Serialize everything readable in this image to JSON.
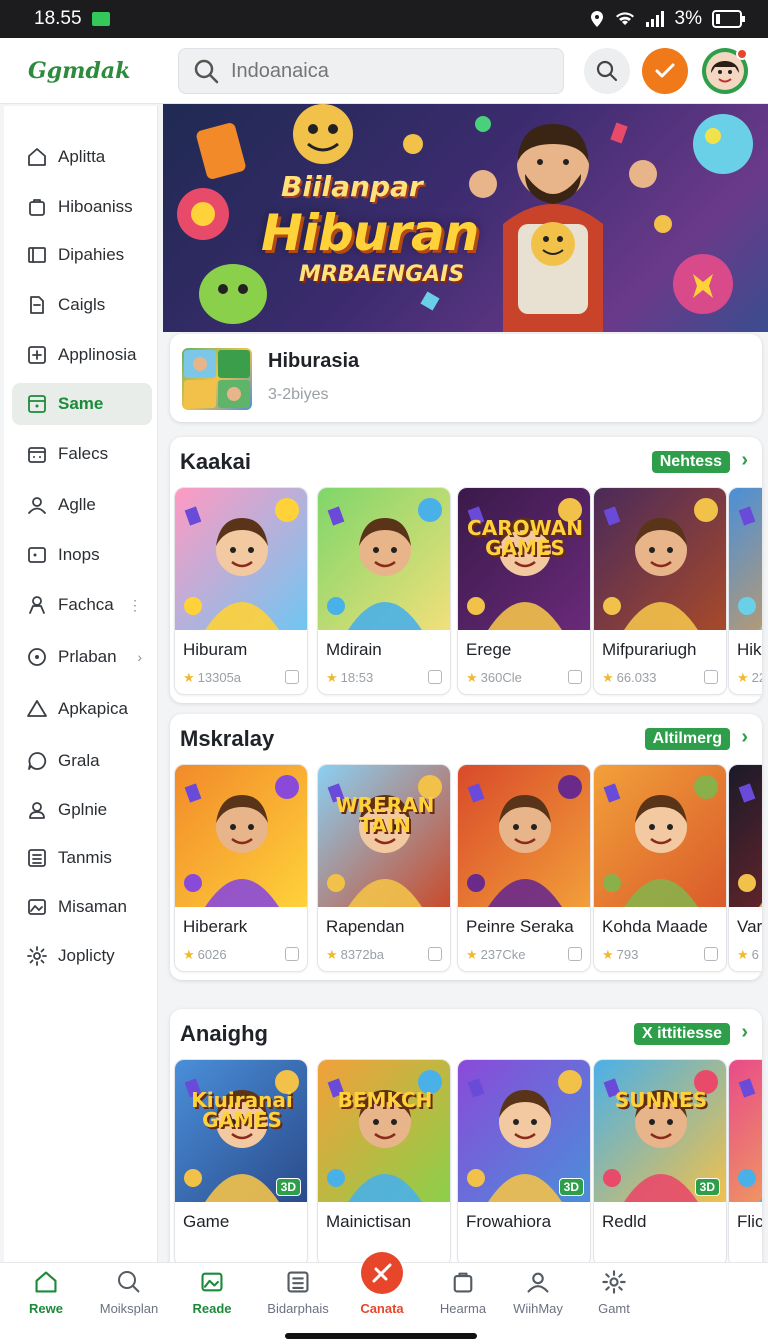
{
  "status": {
    "time": "18.55",
    "battery": "3%"
  },
  "app": {
    "logo": "Ggmdak",
    "search_placeholder": "Indoanaica"
  },
  "sidebar": {
    "items": [
      {
        "label": "Aplitta",
        "icon": "home-icon"
      },
      {
        "label": "Hiboaniss",
        "icon": "bag-icon"
      },
      {
        "label": "Dipahies",
        "icon": "book-icon"
      },
      {
        "label": "Caigls",
        "icon": "doc-icon"
      },
      {
        "label": "Applinosia",
        "icon": "app-icon"
      },
      {
        "label": "Same",
        "icon": "game-icon",
        "active": true
      },
      {
        "label": "Falecs",
        "icon": "calendar-icon"
      },
      {
        "label": "Aglle",
        "icon": "user-icon"
      },
      {
        "label": "Inops",
        "icon": "tv-icon"
      },
      {
        "label": "Fachca",
        "icon": "person-icon",
        "trail": "⋮"
      },
      {
        "label": "Prlaban",
        "icon": "circle-icon",
        "trail": "›"
      },
      {
        "label": "Apkapica",
        "icon": "triangle-icon"
      },
      {
        "label": "Grala",
        "icon": "chat-icon"
      },
      {
        "label": "Gplnie",
        "icon": "profile-icon"
      },
      {
        "label": "Tanmis",
        "icon": "grid-icon"
      },
      {
        "label": "Misaman",
        "icon": "image-icon"
      },
      {
        "label": "Joplicty",
        "icon": "settings-icon"
      }
    ]
  },
  "hero": {
    "line1": "Biilanpar",
    "line2": "Hiburan",
    "line3": "MRBAENGAIS"
  },
  "promo": {
    "title": "Hiburasia",
    "subtitle": "3-2biyes"
  },
  "sections": [
    {
      "title": "Kaakai",
      "pill": "Nehtess",
      "cards": [
        {
          "name": "Hiburam",
          "meta": "13305a",
          "img_text": ""
        },
        {
          "name": "Mdirain",
          "meta": "18:53",
          "img_text": ""
        },
        {
          "name": "Erege",
          "meta": "360Cle",
          "img_text": "CAROWAN GAMES"
        },
        {
          "name": "Mifpurariugh",
          "meta": "66.033",
          "img_text": ""
        },
        {
          "name": "Hiko",
          "meta": "22",
          "img_text": ""
        }
      ]
    },
    {
      "title": "Mskralay",
      "pill": "Altilmerg",
      "cards": [
        {
          "name": "Hiberark",
          "meta": "6026",
          "img_text": ""
        },
        {
          "name": "Rapendan",
          "meta": "8372ba",
          "img_text": "WRERAN TAIN"
        },
        {
          "name": "Peinre Seraka",
          "meta": "237Cke",
          "img_text": ""
        },
        {
          "name": "Kohda Maade",
          "meta": "793",
          "img_text": ""
        },
        {
          "name": "Varc",
          "meta": "6",
          "img_text": ""
        }
      ]
    },
    {
      "title": "Anaighg",
      "pill": "X ittitiesse",
      "cards": [
        {
          "name": "Game",
          "meta": "",
          "img_text": "Kiuiranai GAMES",
          "badge": "3D"
        },
        {
          "name": "Mainictisan",
          "meta": "",
          "img_text": "BEMKCH"
        },
        {
          "name": "Frowahiora",
          "meta": "",
          "img_text": "",
          "badge": "3D"
        },
        {
          "name": "Redld",
          "meta": "",
          "img_text": "SUNNES",
          "badge": "3D"
        },
        {
          "name": "Flic",
          "meta": "",
          "img_text": ""
        }
      ]
    }
  ],
  "bottom_nav": [
    {
      "label": "Rewe",
      "state": "on"
    },
    {
      "label": "Moiksplan",
      "state": ""
    },
    {
      "label": "Reade",
      "state": "on"
    },
    {
      "label": "Bidarphais",
      "state": ""
    },
    {
      "label": "Canata",
      "state": "hot"
    },
    {
      "label": "Hearma",
      "state": ""
    },
    {
      "label": "WiihMay",
      "state": ""
    },
    {
      "label": "Gamt",
      "state": ""
    }
  ],
  "colors": {
    "accent": "#2e9e4a",
    "orange": "#f07a1a",
    "highlight": "#e8462b"
  }
}
